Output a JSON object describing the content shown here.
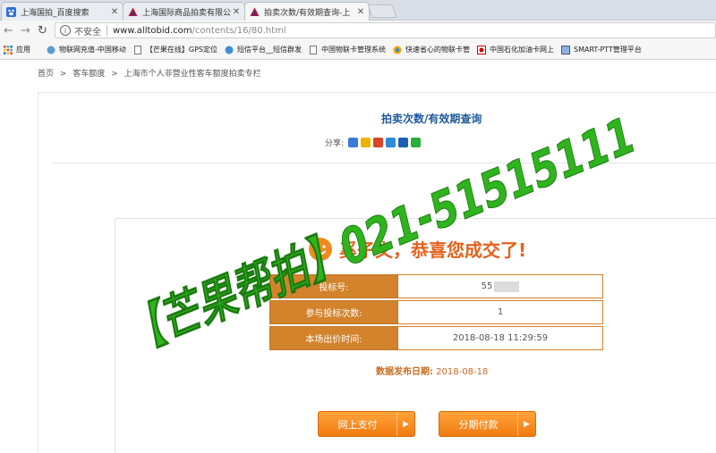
{
  "tabs": [
    {
      "title": "上海国拍_百度搜索",
      "active": false,
      "icon": "baidu-paw-icon"
    },
    {
      "title": "上海国际商品拍卖有限公",
      "active": false,
      "icon": "triangle-logo-icon"
    },
    {
      "title": "拍卖次数/有效期查询-上",
      "active": true,
      "icon": "triangle-logo-icon"
    }
  ],
  "address": {
    "security_label": "不安全",
    "host": "www.alltobid.com",
    "path": "/contents/16/80.html"
  },
  "bookmarks": [
    "应用",
    "物联网充值-中国移动",
    "【芒果在线】GPS定位",
    "短信平台__短信群发",
    "中国物联卡管理系统",
    "快速省心的物联卡管",
    "中国石化加油卡网上",
    "SMART-PTT管理平台"
  ],
  "breadcrumb": [
    "首页",
    ">",
    "客车额度",
    ">",
    "上海市个人非营业性客车额度拍卖专栏"
  ],
  "page": {
    "title": "拍卖次数/有效期查询",
    "share_label": "分享:",
    "congrats": "奚子文，恭喜您成交了!",
    "rows": [
      {
        "label": "投标号:",
        "value": "55"
      },
      {
        "label": "参与投标次数:",
        "value": "1"
      },
      {
        "label": "本场出价时间:",
        "value": "2018-08-18 11:29:59"
      }
    ],
    "pub_date_label": "数据发布日期:",
    "pub_date": "2018-08-18",
    "btn_pay": "网上支付",
    "btn_installment": "分期付款"
  },
  "watermark": {
    "text": "【芒果帮拍】021-51515111",
    "color": "#2fb41d"
  },
  "colors": {
    "accent_orange": "#d2832b",
    "title_blue": "#1d5a9c",
    "button_orange": "#f5891f"
  }
}
